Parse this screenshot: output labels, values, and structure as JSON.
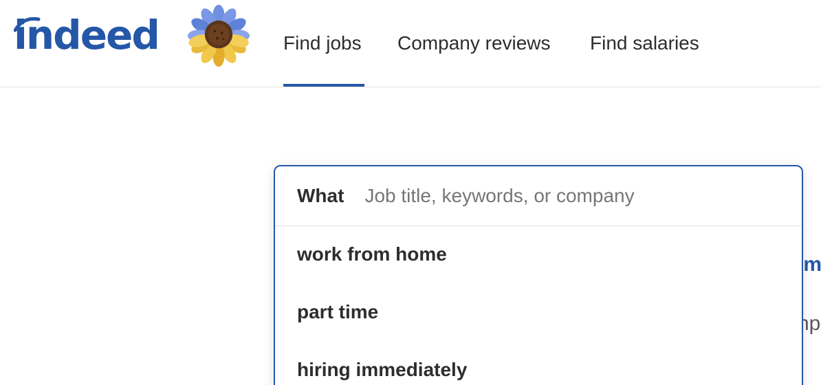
{
  "header": {
    "logo_text": "indeed",
    "nav": [
      {
        "label": "Find jobs",
        "active": true
      },
      {
        "label": "Company reviews",
        "active": false
      },
      {
        "label": "Find salaries",
        "active": false
      }
    ]
  },
  "search": {
    "what_label": "What",
    "placeholder": "Job title, keywords, or company",
    "value": "",
    "suggestions": [
      "work from home",
      "part time",
      "hiring immediately"
    ]
  },
  "background_partial": {
    "blue_fragment": "ım",
    "gray_fragment": "np"
  },
  "colors": {
    "brand": "#2557a7",
    "text": "#2d2d2d",
    "placeholder": "#767676",
    "divider": "#e4e2e0"
  },
  "icons": [
    "indeed-logo",
    "sunflower-icon"
  ]
}
